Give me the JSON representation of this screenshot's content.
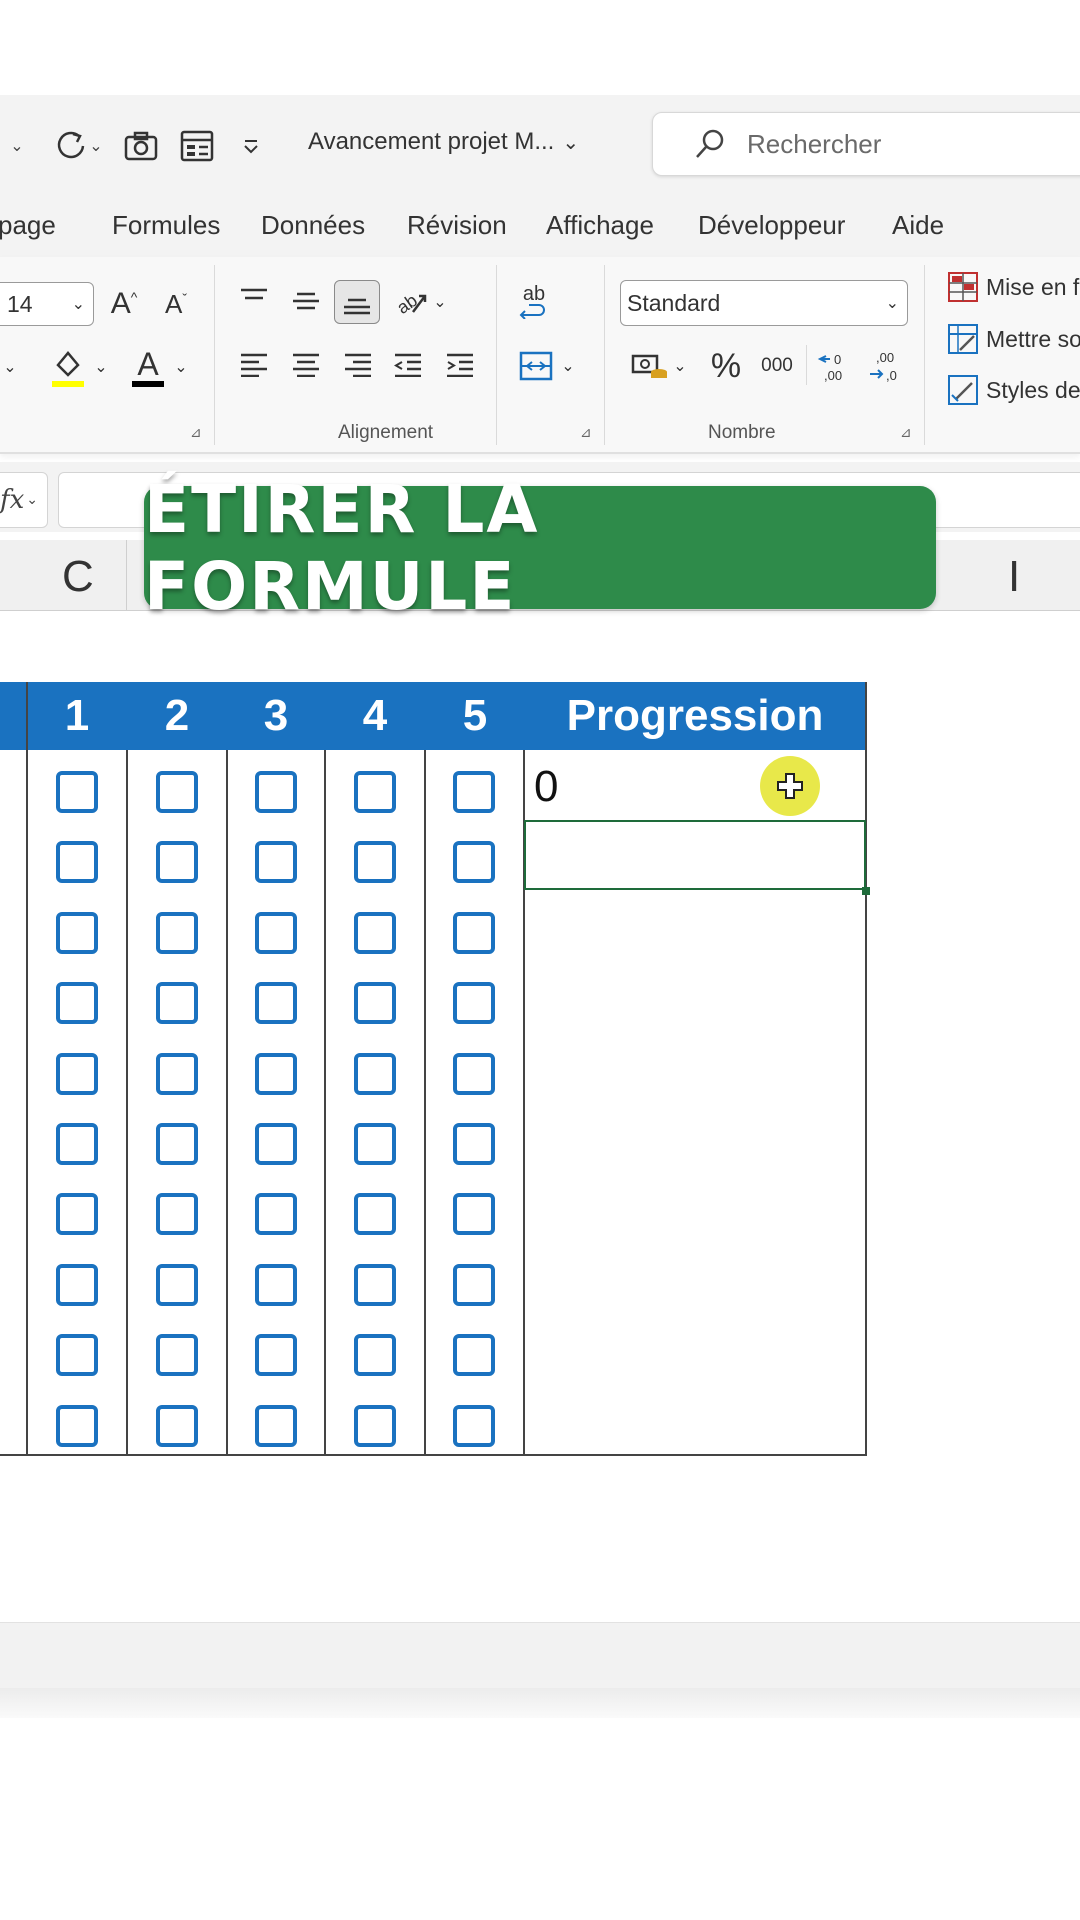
{
  "titlebar": {
    "document_title": "Avancement projet M...",
    "search_placeholder": "Rechercher"
  },
  "menu": {
    "items": [
      "page",
      "Formules",
      "Données",
      "Révision",
      "Affichage",
      "Développeur",
      "Aide"
    ]
  },
  "ribbon": {
    "font_size": "14",
    "number_format": "Standard",
    "percent_symbol": "%",
    "thousands_symbol": "000",
    "wrap_label": "ab",
    "groups": {
      "alignment": "Alignement",
      "number": "Nombre"
    },
    "styles": [
      "Mise en f",
      "Mettre so",
      "Styles de"
    ],
    "colors": {
      "highlight": "#ffff00",
      "font_color": "#000000"
    }
  },
  "formula_bar": {
    "fx_label": "fx"
  },
  "column_headers": {
    "c": "C",
    "i": "I"
  },
  "banner": {
    "text": "ÉTIRER LA FORMULE",
    "color": "#2e8b4a"
  },
  "table": {
    "header_color": "#1a72c0",
    "headers": [
      "1",
      "2",
      "3",
      "4",
      "5",
      "Progression"
    ],
    "first_progression_value": "0",
    "row_count": 10
  },
  "icons": {
    "quick_access": [
      "undo-icon",
      "redo-icon",
      "camera-icon",
      "form-icon",
      "customize-icon"
    ],
    "cursor": "fill-cursor-icon"
  }
}
